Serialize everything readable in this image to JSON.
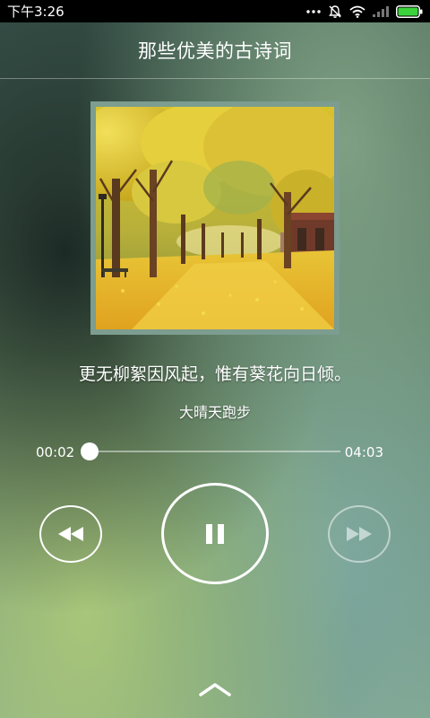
{
  "status_bar": {
    "time": "下午3:26",
    "icons": [
      "more-dots-icon",
      "alarm-off-icon",
      "wifi-icon",
      "signal-icon",
      "battery-icon"
    ]
  },
  "header": {
    "title": "那些优美的古诗词"
  },
  "player": {
    "album_art": "album-cover-ginkgo-path",
    "lyric": "更无柳絮因风起，惟有葵花向日倾。",
    "artist": "大晴天跑步",
    "time_elapsed": "00:02",
    "time_total": "04:03",
    "progress_fraction": 0.008,
    "controls": {
      "prev": "rewind-icon",
      "play_pause": "pause-icon",
      "next": "fast-forward-icon"
    }
  },
  "footer": {
    "expand": "chevron-up-icon"
  }
}
